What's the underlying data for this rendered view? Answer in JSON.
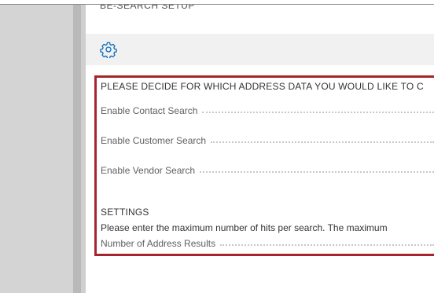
{
  "page": {
    "title": "BE-SEARCH SETUP"
  },
  "actions": {
    "settings_icon": "gear-icon"
  },
  "section_address": {
    "heading": "PLEASE DECIDE FOR WHICH ADDRESS DATA YOU WOULD LIKE TO C",
    "fields": [
      {
        "label": "Enable Contact Search"
      },
      {
        "label": "Enable Customer Search"
      },
      {
        "label": "Enable Vendor Search"
      }
    ]
  },
  "section_settings": {
    "heading": "SETTINGS",
    "instruction": "Please enter the maximum number of hits per search. The maximum",
    "fields": [
      {
        "label": "Number of Address Results"
      }
    ]
  },
  "colors": {
    "highlight_border": "#a4262c",
    "action_bar": "#f1f1f1",
    "gear": "#0f6cbd"
  }
}
